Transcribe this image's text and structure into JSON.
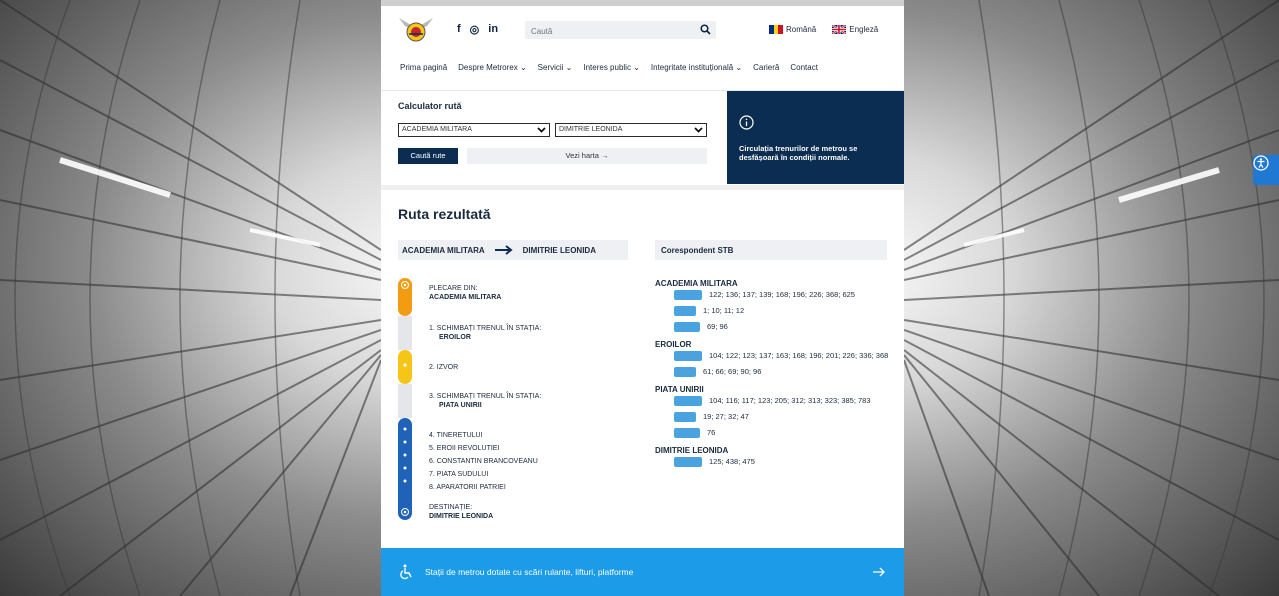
{
  "header": {
    "social": [
      "f",
      "◎",
      "in"
    ],
    "search_placeholder": "Caută",
    "lang_ro": "Română",
    "lang_en": "Engleză"
  },
  "nav": [
    "Prima pagină",
    "Despre Metrorex",
    "Servicii",
    "Interes public",
    "Integritate instituțională",
    "Carieră",
    "Contact"
  ],
  "calculator": {
    "title": "Calculator rută",
    "from": "ACADEMIA MILITARA",
    "to": "DIMITRIE LEONIDA",
    "search_button": "Caută rute",
    "map_button": "Vezi harta →"
  },
  "info": {
    "message": "Circulația trenurilor de metrou se desfășoară în condiții normale."
  },
  "results": {
    "title": "Ruta rezultată",
    "route_from": "ACADEMIA MILITARA",
    "route_to": "DIMITRIE LEONIDA",
    "stb_header": "Corespondent STB",
    "departure_label": "PLECARE DIN:",
    "departure": "ACADEMIA MILITARA",
    "step1_label": "1. SCHIMBAȚI TRENUL ÎN STAȚIA:",
    "step1_station": "EROILOR",
    "step2": "2. IZVOR",
    "step3_label": "3. SCHIMBAȚI TRENUL ÎN STAȚIA:",
    "step3_station": "PIATA UNIRII",
    "step4": "4. TINERETULUI",
    "step5": "5. EROII REVOLUTIEI",
    "step6": "6. CONSTANTIN BRANCOVEANU",
    "step7": "7. PIATA SUDULUI",
    "step8": "8. APARATORII PATRIEI",
    "destination_label": "DESTINAȚIE:",
    "destination": "DIMITRIE LEONIDA"
  },
  "stb": [
    {
      "station": "ACADEMIA MILITARA",
      "lines": [
        "122; 136; 137; 139; 168; 196; 226; 368; 625",
        "1; 10; 11; 12",
        "69; 96"
      ]
    },
    {
      "station": "EROILOR",
      "lines": [
        "104; 122; 123; 137; 163; 168; 196; 201; 226; 336; 368",
        "61; 66; 69; 90; 96"
      ]
    },
    {
      "station": "PIATA UNIRII",
      "lines": [
        "104; 116; 117; 123; 205; 312; 313; 323; 385; 783",
        "19; 27; 32; 47",
        "76"
      ]
    },
    {
      "station": "DIMITRIE LEONIDA",
      "lines": [
        "125; 438; 475"
      ]
    }
  ],
  "footer": {
    "text": "Stații de metrou dotate cu scări rulante, lifturi, platforme"
  },
  "colors": {
    "navy": "#0c2d52",
    "line_orange": "#f39c12",
    "line_yellow": "#f5c518",
    "line_blue": "#1f62b8",
    "footer_blue": "#1c9be8"
  }
}
